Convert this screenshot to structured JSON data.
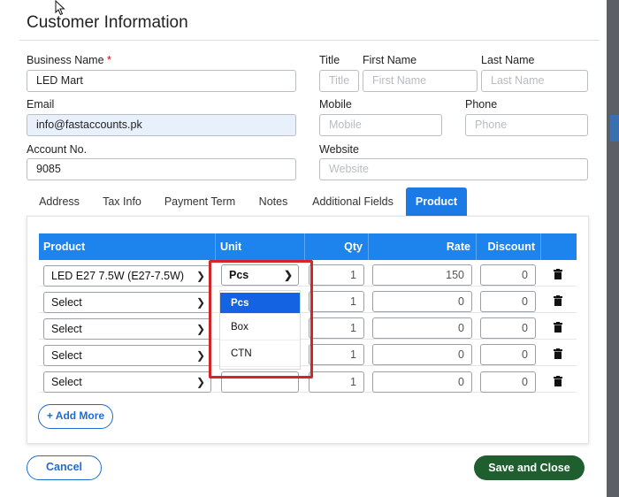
{
  "dialog": {
    "title": "Customer Information"
  },
  "form": {
    "business_name": {
      "label": "Business Name",
      "required_mark": "*",
      "value": "LED Mart"
    },
    "title": {
      "label": "Title",
      "placeholder": "Title"
    },
    "first_name": {
      "label": "First Name",
      "placeholder": "First Name"
    },
    "last_name": {
      "label": "Last Name",
      "placeholder": "Last Name"
    },
    "email": {
      "label": "Email",
      "value": "info@fastaccounts.pk"
    },
    "mobile": {
      "label": "Mobile",
      "placeholder": "Mobile"
    },
    "phone": {
      "label": "Phone",
      "placeholder": "Phone"
    },
    "account_no": {
      "label": "Account No.",
      "value": "9085"
    },
    "website": {
      "label": "Website",
      "placeholder": "Website"
    }
  },
  "tabs": [
    {
      "label": "Address"
    },
    {
      "label": "Tax Info"
    },
    {
      "label": "Payment Term"
    },
    {
      "label": "Notes"
    },
    {
      "label": "Additional Fields"
    },
    {
      "label": "Product",
      "active": true
    }
  ],
  "table": {
    "headers": {
      "product": "Product",
      "unit": "Unit",
      "qty": "Qty",
      "rate": "Rate",
      "discount": "Discount"
    },
    "rows": [
      {
        "product": "LED E27 7.5W (E27-7.5W)",
        "unit": "Pcs",
        "qty": "1",
        "rate": "150",
        "discount": "0"
      },
      {
        "product": "Select",
        "unit": "",
        "qty": "1",
        "rate": "0",
        "discount": "0"
      },
      {
        "product": "Select",
        "unit": "",
        "qty": "1",
        "rate": "0",
        "discount": "0"
      },
      {
        "product": "Select",
        "unit": "",
        "qty": "1",
        "rate": "0",
        "discount": "0"
      },
      {
        "product": "Select",
        "unit": "",
        "qty": "1",
        "rate": "0",
        "discount": "0"
      }
    ]
  },
  "unit_dropdown": {
    "options": [
      "Pcs",
      "Box",
      "CTN"
    ],
    "selected": "Pcs"
  },
  "buttons": {
    "add_more": "+ Add More",
    "cancel": "Cancel",
    "save_close": "Save and Close"
  },
  "colors": {
    "primary": "#1c84ec",
    "save": "#1e5e2f",
    "highlight": "#d3262b"
  }
}
